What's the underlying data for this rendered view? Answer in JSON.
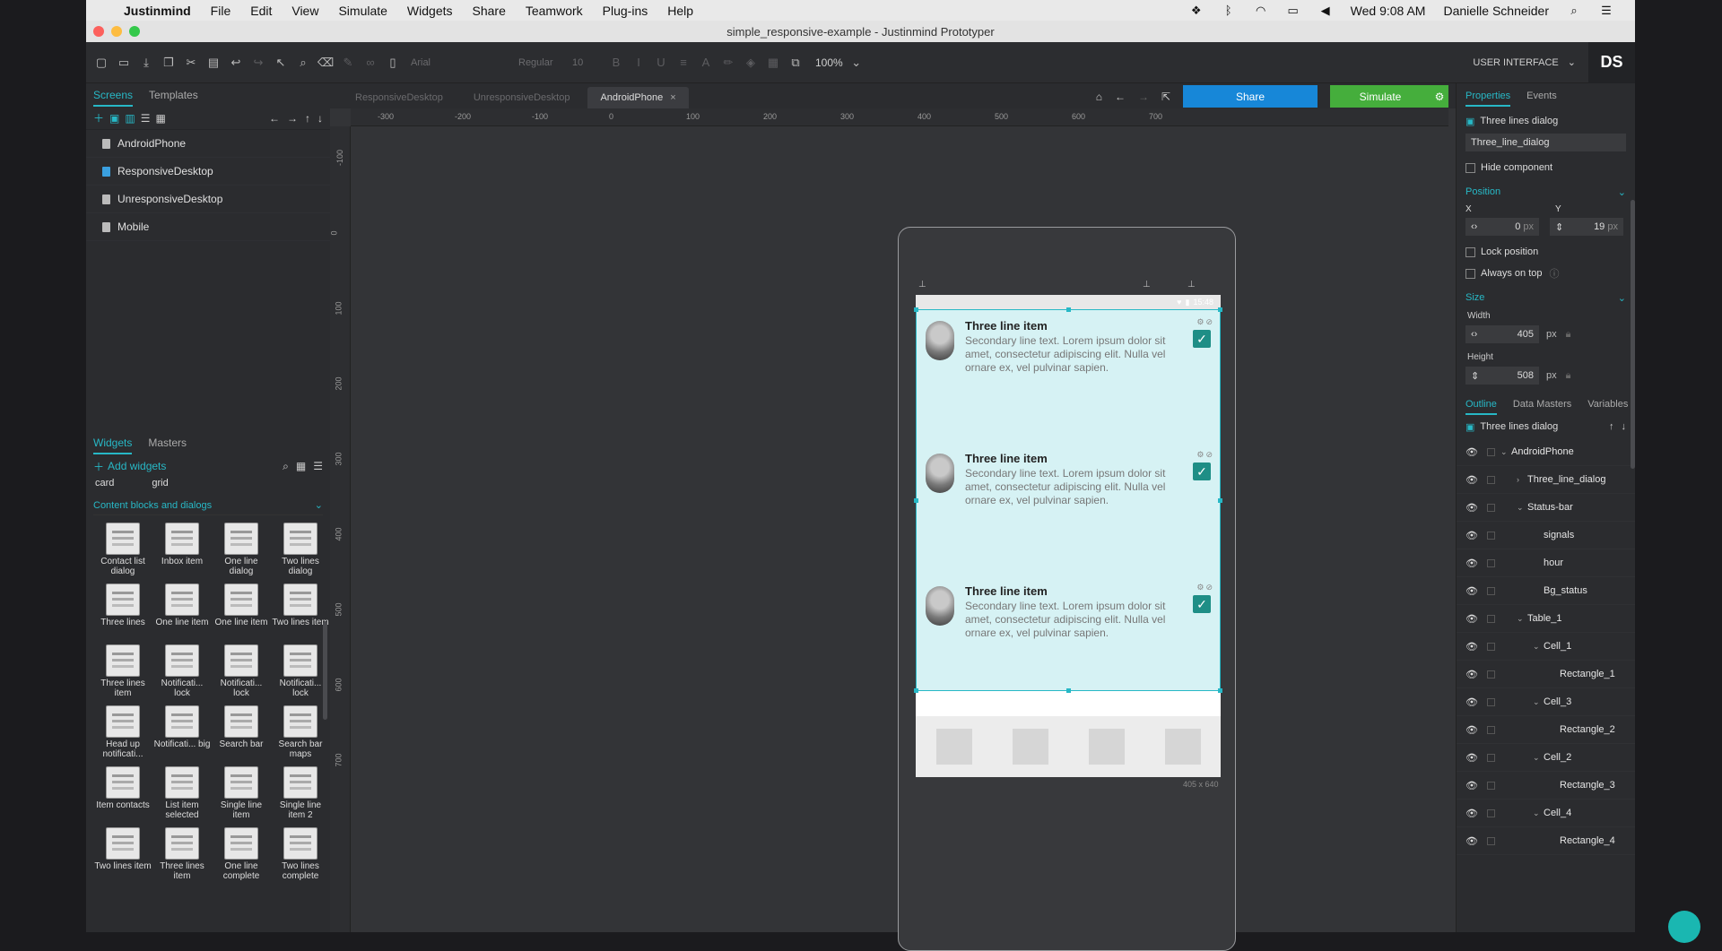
{
  "menubar": {
    "items": [
      "Justinmind",
      "File",
      "Edit",
      "View",
      "Simulate",
      "Widgets",
      "Share",
      "Teamwork",
      "Plug-ins",
      "Help"
    ],
    "clock": "Wed 9:08 AM",
    "user": "Danielle Schneider"
  },
  "window": {
    "title": "simple_responsive-example - Justinmind Prototyper"
  },
  "toolbar": {
    "font": "Arial",
    "style": "Regular",
    "size": "10",
    "zoom": "100%",
    "mode": "USER INTERFACE",
    "avatar": "DS"
  },
  "left": {
    "tabs": [
      "Screens",
      "Templates"
    ],
    "screens": [
      "AndroidPhone",
      "ResponsiveDesktop",
      "UnresponsiveDesktop",
      "Mobile"
    ],
    "widget_tabs": [
      "Widgets",
      "Masters"
    ],
    "add_widgets": "Add widgets",
    "top_labels": [
      "card",
      "grid"
    ],
    "section": "Content blocks and dialogs",
    "widgets": [
      "Contact list dialog",
      "Inbox item",
      "One line dialog",
      "Two lines dialog",
      "Three lines",
      "One line item",
      "One line item",
      "Two lines item",
      "Three lines item",
      "Notificati... lock",
      "Notificati... lock",
      "Notificati... lock",
      "Head up notificati...",
      "Notificati... big",
      "Search bar",
      "Search bar maps",
      "Item contacts",
      "List item selected",
      "Single line item",
      "Single line item 2",
      "Two lines item",
      "Three lines item",
      "One line complete",
      "Two lines complete"
    ]
  },
  "center": {
    "tabs": [
      "ResponsiveDesktop",
      "UnresponsiveDesktop",
      "AndroidPhone"
    ],
    "share": "Share",
    "simulate": "Simulate",
    "ruler_h": [
      "-300",
      "-200",
      "-100",
      "0",
      "100",
      "200",
      "300",
      "400",
      "500",
      "600",
      "700"
    ],
    "ruler_v": [
      "-100",
      "0",
      "100",
      "200",
      "300",
      "400",
      "500",
      "600",
      "700"
    ],
    "status_time": "15:48",
    "items": [
      {
        "title": "Three line item",
        "body": "Secondary line text. Lorem ipsum dolor sit amet, consectetur adipiscing elit. Nulla vel ornare ex, vel pulvinar sapien."
      },
      {
        "title": "Three line item",
        "body": "Secondary line text. Lorem ipsum dolor sit amet, consectetur adipiscing elit. Nulla vel ornare ex, vel pulvinar sapien."
      },
      {
        "title": "Three line item",
        "body": "Secondary line text. Lorem ipsum dolor sit amet, consectetur adipiscing elit. Nulla vel ornare ex, vel pulvinar sapien."
      }
    ],
    "dims": "405 x 640"
  },
  "right": {
    "tabs": [
      "Properties",
      "Events"
    ],
    "component_type": "Three lines dialog",
    "name": "Three_line_dialog",
    "hide": "Hide component",
    "position": "Position",
    "x_label": "X",
    "y_label": "Y",
    "x": "0",
    "y": "19",
    "px": "px",
    "lock": "Lock position",
    "on_top": "Always on top",
    "size": "Size",
    "width_label": "Width",
    "height_label": "Height",
    "width": "405",
    "height": "508",
    "outline_tabs": [
      "Outline",
      "Data Masters",
      "Variables"
    ],
    "outline_title": "Three lines dialog",
    "outline": [
      "AndroidPhone",
      "Three_line_dialog",
      "Status-bar",
      "signals",
      "hour",
      "Bg_status",
      "Table_1",
      "Cell_1",
      "Rectangle_1",
      "Cell_3",
      "Rectangle_2",
      "Cell_2",
      "Rectangle_3",
      "Cell_4",
      "Rectangle_4"
    ]
  }
}
